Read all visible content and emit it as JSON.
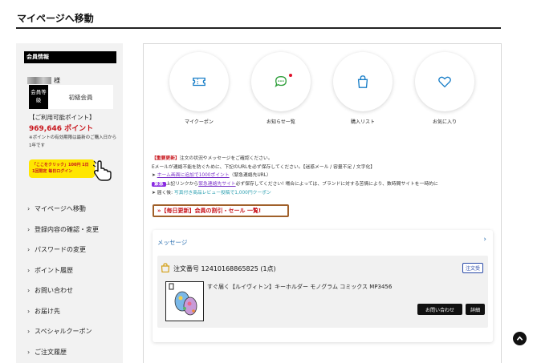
{
  "page": {
    "title": "マイページへ移動"
  },
  "sidebar": {
    "section_title": "会員情報",
    "honorific": "様",
    "rank_label": "会員等級",
    "rank_value": "初級会員",
    "points_label": "【ご利用可能ポイント】",
    "points_value": "969,646 ポイント",
    "points_note": "※ポイントの有効期限は最新のご購入日から1年です",
    "campaign_banner": "「ここをクリック」100円 1日1回限定 毎日ログイン",
    "nav_items": [
      {
        "label": "マイページへ移動"
      },
      {
        "label": "登録内容の確認・変更"
      },
      {
        "label": "パスワードの変更"
      },
      {
        "label": "ポイント履歴"
      },
      {
        "label": "お問い合わせ"
      },
      {
        "label": "お届け先"
      },
      {
        "label": "スペシャルクーポン"
      },
      {
        "label": "ご注文履歴"
      }
    ]
  },
  "main": {
    "shortcuts": [
      {
        "label": "マイクーポン",
        "icon": "ticket-icon"
      },
      {
        "label": "お知らせ一覧",
        "icon": "chat-bubble-icon"
      },
      {
        "label": "購入リスト",
        "icon": "shopping-bag-icon"
      },
      {
        "label": "お気に入り",
        "icon": "heart-icon"
      }
    ],
    "notice": {
      "line1_tag": "【重要更新】",
      "line1_text": "注文の状況やメッセージをご確認ください。",
      "line2_text": "Eメールが連絡不能を防ぐために、下記のURLを必ず保存してください。【迷惑メール / 容量不足 / 文字化】",
      "line3_prefix": "➤ ",
      "line3_link": "ホーム画面に追加で1000ポイント",
      "line3_suffix": "（緊急連絡先URL）",
      "line4_tag": "緊急",
      "line4_text_a": "上記リンクから",
      "line4_link": "緊急連絡先サイト",
      "line4_text_b": "必ず保存してください! 場合によっては、ブランドに対する苦情により、数時間サイトを一時的に",
      "line5_prefix": "➤ 届く後: ",
      "line5_text": "写真付き商品レビュー投稿で1,000円クーポン"
    },
    "sale_banner": "»【毎日更新】会員の割引・セール 一覧!",
    "message_card": {
      "header": "メッセージ",
      "order_number": "注文番号 12410168865825 (1点)",
      "status": "注文受",
      "product_name": "すぐ届く【ルイヴィトン】キーホルダー モノグラム コミックス MP3456",
      "inquiry_button": "お問い合わせ",
      "detail_button": "詳細"
    }
  },
  "colors": {
    "accent_red": "#c8161d",
    "link_blue": "#2a6fb0",
    "icon_teal": "#1a7fc8"
  }
}
